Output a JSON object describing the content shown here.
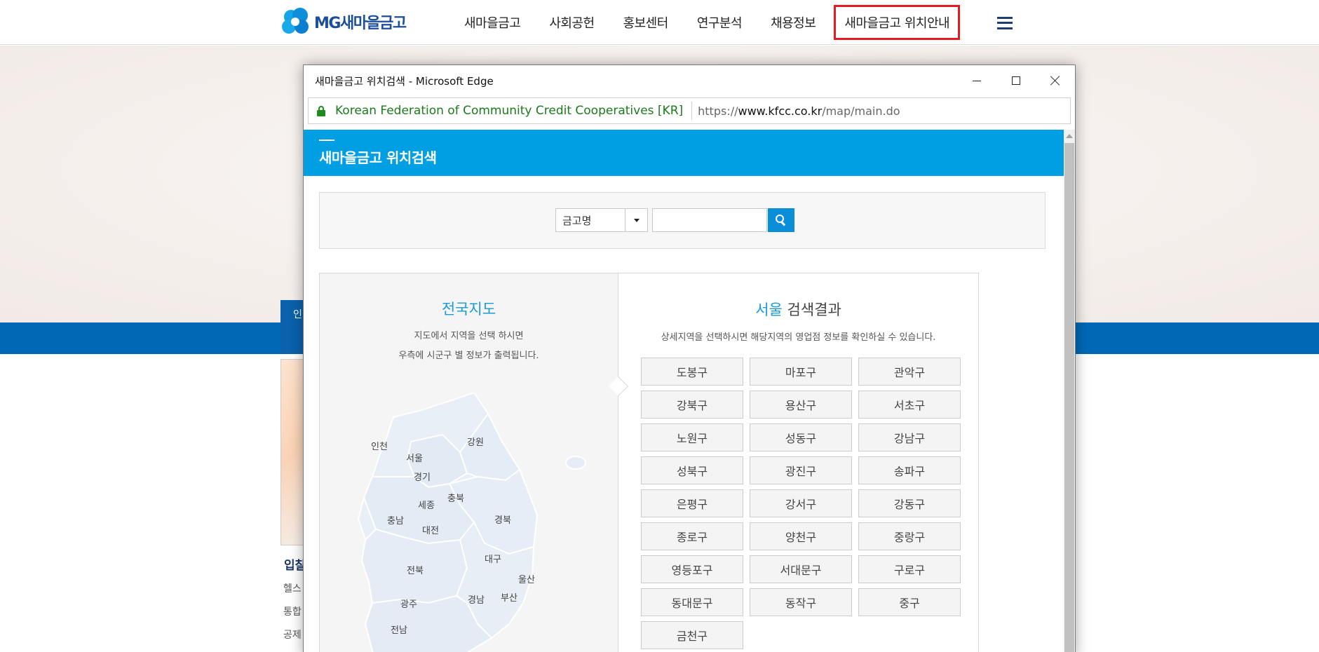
{
  "site": {
    "logo_text": "MG새마을금고",
    "nav": [
      "새마을금고",
      "사회공헌",
      "홍보센터",
      "연구분석",
      "채용정보",
      "새마을금고 위치안내"
    ],
    "side_tab": "인",
    "side_heading": "입찰",
    "side_links": [
      "헬스",
      "통합",
      "공제"
    ]
  },
  "window": {
    "title": "새마을금고 위치검색 - Microsoft Edge",
    "cert_name": "Korean Federation of Community Credit Cooperatives [KR]",
    "url_prefix": "https://",
    "url_domain": "www.kfcc.co.kr",
    "url_path": "/map/main.do"
  },
  "popup": {
    "title": "새마을금고 위치검색",
    "search": {
      "select_value": "금고명",
      "input_value": ""
    },
    "map": {
      "title": "전국지도",
      "desc_line1": "지도에서 지역을 선택 하시면",
      "desc_line2": "우측에 시군구 별 정보가 출력됩니다.",
      "regions": [
        "인천",
        "서울",
        "강원",
        "경기",
        "충북",
        "세종",
        "충남",
        "경북",
        "대전",
        "대구",
        "전북",
        "울산",
        "경남",
        "부산",
        "광주",
        "전남"
      ]
    },
    "results": {
      "region": "서울",
      "title_suffix": "검색결과",
      "desc": "상세지역을 선택하시면 해당지역의 영업점 정보를 확인하실 수 있습니다.",
      "districts": [
        "도봉구",
        "마포구",
        "관악구",
        "강북구",
        "용산구",
        "서초구",
        "노원구",
        "성동구",
        "강남구",
        "성북구",
        "광진구",
        "송파구",
        "은평구",
        "강서구",
        "강동구",
        "종로구",
        "양천구",
        "중랑구",
        "영등포구",
        "서대문구",
        "구로구",
        "동대문구",
        "동작구",
        "중구",
        "금천구"
      ]
    }
  },
  "colors": {
    "brand_blue": "#009ee2",
    "site_band": "#0068b5",
    "highlight_red": "#e31b23",
    "cert_green": "#1b7a1b"
  }
}
